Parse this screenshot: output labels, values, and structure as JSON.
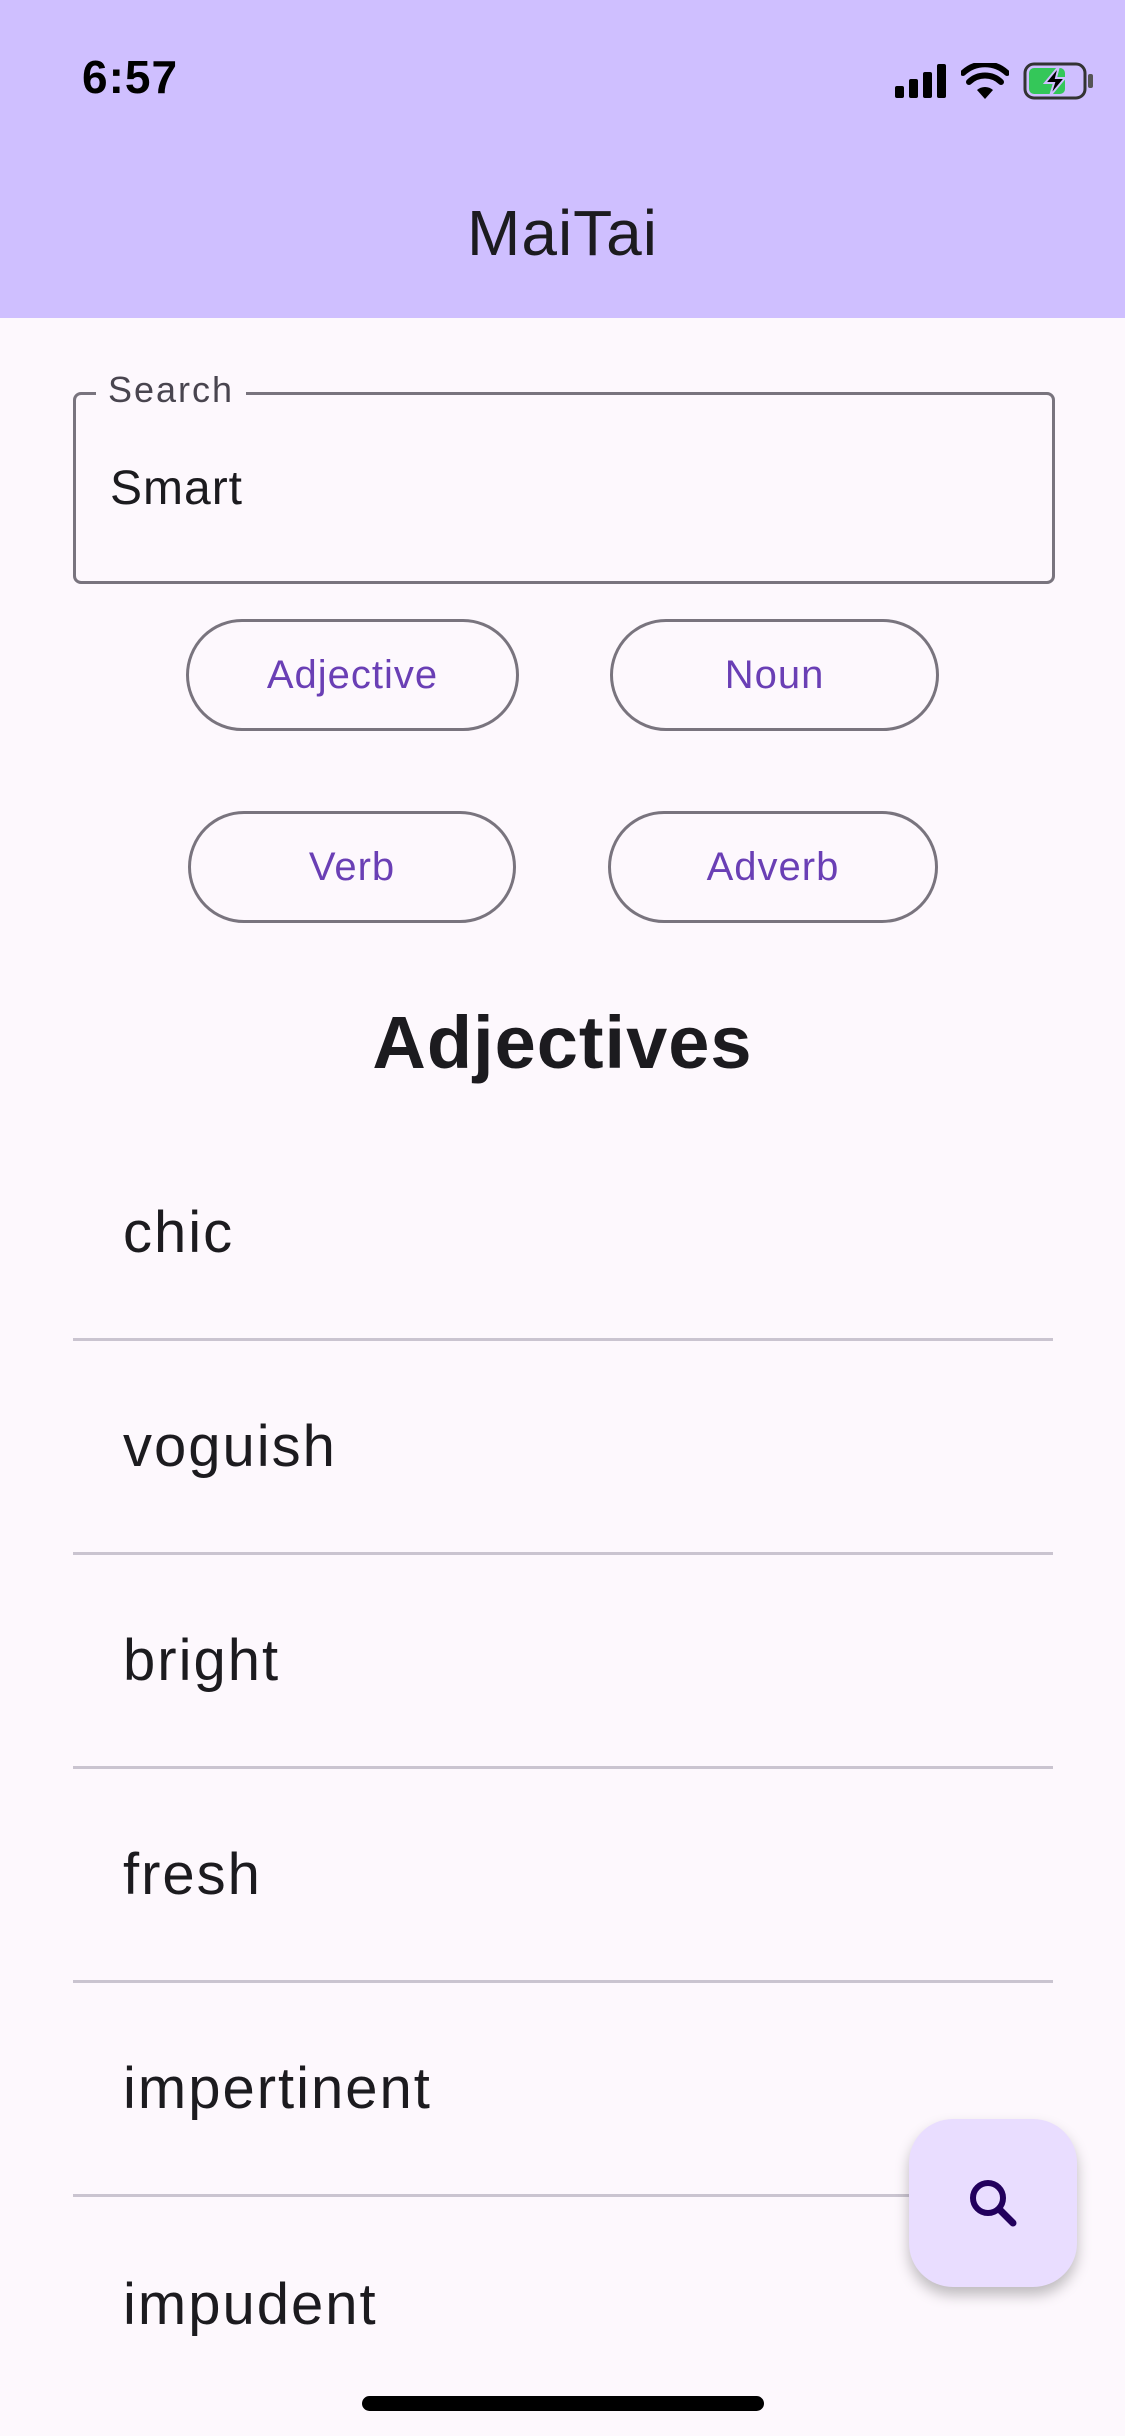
{
  "status_bar": {
    "time": "6:57",
    "icons": [
      "cellular-signal-icon",
      "wifi-icon",
      "battery-charging-icon"
    ]
  },
  "app_bar": {
    "title": "MaiTai",
    "background": "#cfbfff"
  },
  "search": {
    "label": "Search",
    "value": "Smart"
  },
  "filters": [
    {
      "label": "Adjective"
    },
    {
      "label": "Noun"
    },
    {
      "label": "Verb"
    },
    {
      "label": "Adverb"
    }
  ],
  "results": {
    "heading": "Adjectives",
    "items": [
      "chic",
      "voguish",
      "bright",
      "fresh",
      "impertinent",
      "impudent"
    ]
  },
  "fab": {
    "icon": "search-icon"
  },
  "colors": {
    "accent": "#6a3fb5",
    "fab_bg": "#e9ddff",
    "divider": "#cac4d0"
  }
}
